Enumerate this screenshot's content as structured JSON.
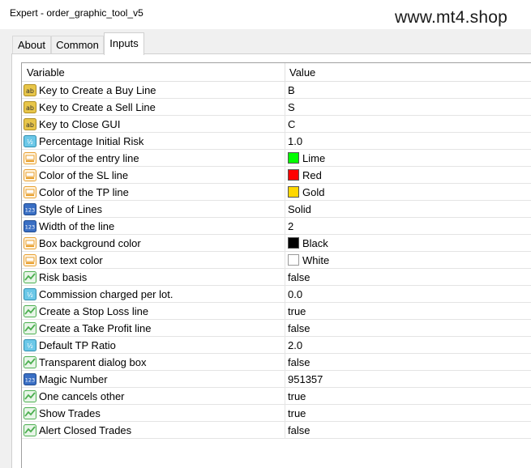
{
  "window": {
    "title": "Expert - order_graphic_tool_v5",
    "watermark": "www.mt4.shop"
  },
  "tabs": [
    {
      "label": "About",
      "active": false
    },
    {
      "label": "Common",
      "active": false
    },
    {
      "label": "Inputs",
      "active": true
    }
  ],
  "grid": {
    "headers": {
      "variable": "Variable",
      "value": "Value"
    },
    "rows": [
      {
        "icon": "ab-string-icon",
        "name": "Key to Create a Buy Line",
        "value": "B"
      },
      {
        "icon": "ab-string-icon",
        "name": "Key to Create a Sell Line",
        "value": "S"
      },
      {
        "icon": "ab-string-icon",
        "name": "Key to Close GUI",
        "value": "C"
      },
      {
        "icon": "fraction-double-icon",
        "name": "Percentage Initial Risk",
        "value": "1.0"
      },
      {
        "icon": "color-palette-icon",
        "name": "Color of the entry line",
        "value": "Lime",
        "color": "#00ff00"
      },
      {
        "icon": "color-palette-icon",
        "name": "Color of the SL line",
        "value": "Red",
        "color": "#ff0000"
      },
      {
        "icon": "color-palette-icon",
        "name": "Color of the TP line",
        "value": "Gold",
        "color": "#ffd700"
      },
      {
        "icon": "integer-123-icon",
        "name": "Style of Lines",
        "value": "Solid"
      },
      {
        "icon": "integer-123-icon",
        "name": "Width of the line",
        "value": "2"
      },
      {
        "icon": "color-palette-icon",
        "name": "Box background color",
        "value": "Black",
        "color": "#000000"
      },
      {
        "icon": "color-palette-icon",
        "name": "Box text color",
        "value": "White",
        "color": "#ffffff"
      },
      {
        "icon": "boolean-chart-icon",
        "name": "Risk basis",
        "value": "false"
      },
      {
        "icon": "fraction-double-icon",
        "name": "Commission charged per lot.",
        "value": "0.0"
      },
      {
        "icon": "boolean-chart-icon",
        "name": "Create a Stop Loss line",
        "value": "true"
      },
      {
        "icon": "boolean-chart-icon",
        "name": "Create a Take Profit line",
        "value": "false"
      },
      {
        "icon": "fraction-double-icon",
        "name": "Default TP Ratio",
        "value": "2.0"
      },
      {
        "icon": "boolean-chart-icon",
        "name": "Transparent dialog box",
        "value": "false"
      },
      {
        "icon": "integer-123-icon",
        "name": "Magic Number",
        "value": "951357"
      },
      {
        "icon": "boolean-chart-icon",
        "name": "One cancels other",
        "value": "true"
      },
      {
        "icon": "boolean-chart-icon",
        "name": "Show Trades",
        "value": "true"
      },
      {
        "icon": "boolean-chart-icon",
        "name": "Alert Closed Trades",
        "value": "false"
      }
    ]
  },
  "colors": {
    "ab_icon": "#e8c64a",
    "double_icon": "#6cc8e8",
    "int_icon": "#3a6fc4",
    "bool_icon": "#4caf50",
    "color_icon": "#e8a030"
  }
}
